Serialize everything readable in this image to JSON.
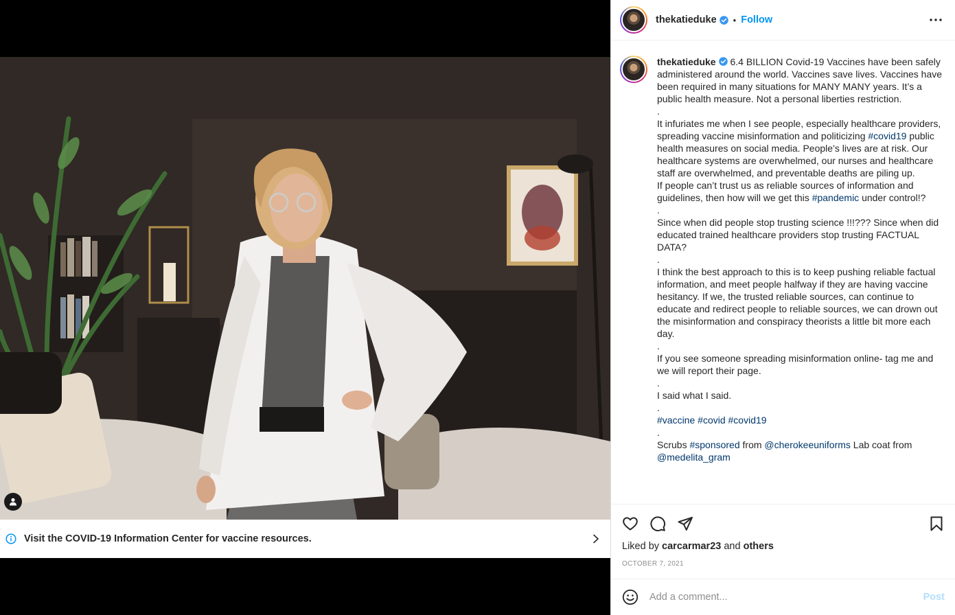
{
  "post": {
    "username": "thekatieduke",
    "verified": true,
    "follow_label": "Follow",
    "separator": "•",
    "more_icon": "more-horizontal-icon"
  },
  "media": {
    "info_banner": "Visit the COVID-19 Information Center for vaccine resources.",
    "info_icon": "info-circle-icon",
    "chevron_icon": "chevron-right-icon",
    "tag_icon": "user-tag-icon"
  },
  "caption": {
    "username": "thekatieduke",
    "segments": {
      "p1": "6.4 BILLION Covid-19 Vaccines have been safely administered around the world. Vaccines save lives. Vaccines have been required in many situations for MANY MANY years. It’s a public health measure. Not a personal liberties restriction.",
      "dot": ".",
      "p2a": "It infuriates me when I see people, especially healthcare providers, spreading vaccine misinformation and politicizing ",
      "tag_covid19": "#covid19",
      "p2b": " public health measures on social media. People’s lives are at risk. Our healthcare systems are overwhelmed, our nurses and healthcare staff are overwhelmed, and preventable deaths are piling up.",
      "p3a": "If people can’t trust us as reliable sources of information and guidelines, then how will we get this ",
      "tag_pandemic": "#pandemic",
      "p3b": " under control!?",
      "p4": "Since when did people stop trusting science !!!??? Since when did educated trained healthcare providers stop trusting FACTUAL DATA?",
      "p5": "I think the best approach to this is to keep pushing reliable factual information, and meet people halfway if they are having vaccine hesitancy. If we, the trusted reliable sources, can continue to educate and redirect people to reliable sources, we can drown out the misinformation and conspiracy theorists a little bit more each day.",
      "p6": "If you see someone spreading misinformation online- tag me and we will report their page.",
      "p7": "I said what I said.",
      "tag_vaccine": "#vaccine",
      "tag_covid": "#covid",
      "tag_covid19b": "#covid19",
      "p8a": "Scrubs ",
      "tag_sponsored": "#sponsored",
      "p8b": " from ",
      "mention_cherokee": "@cherokeeuniforms",
      "p8c": " Lab coat from",
      "mention_medelita": "@medelita_gram"
    }
  },
  "actions": {
    "like_icon": "heart-icon",
    "comment_icon": "comment-bubble-icon",
    "share_icon": "paper-plane-icon",
    "save_icon": "bookmark-icon",
    "liked_prefix": "Liked by",
    "liked_user": "carcarmar23",
    "liked_and": "and",
    "liked_others": "others",
    "date": "OCTOBER 7, 2021"
  },
  "comment": {
    "emoji_icon": "emoji-smile-icon",
    "placeholder": "Add a comment...",
    "post_label": "Post"
  },
  "colors": {
    "link": "#0095f6",
    "hashtag": "#00376b",
    "muted": "#8e8e8e",
    "post_disabled": "#b2dffc"
  }
}
